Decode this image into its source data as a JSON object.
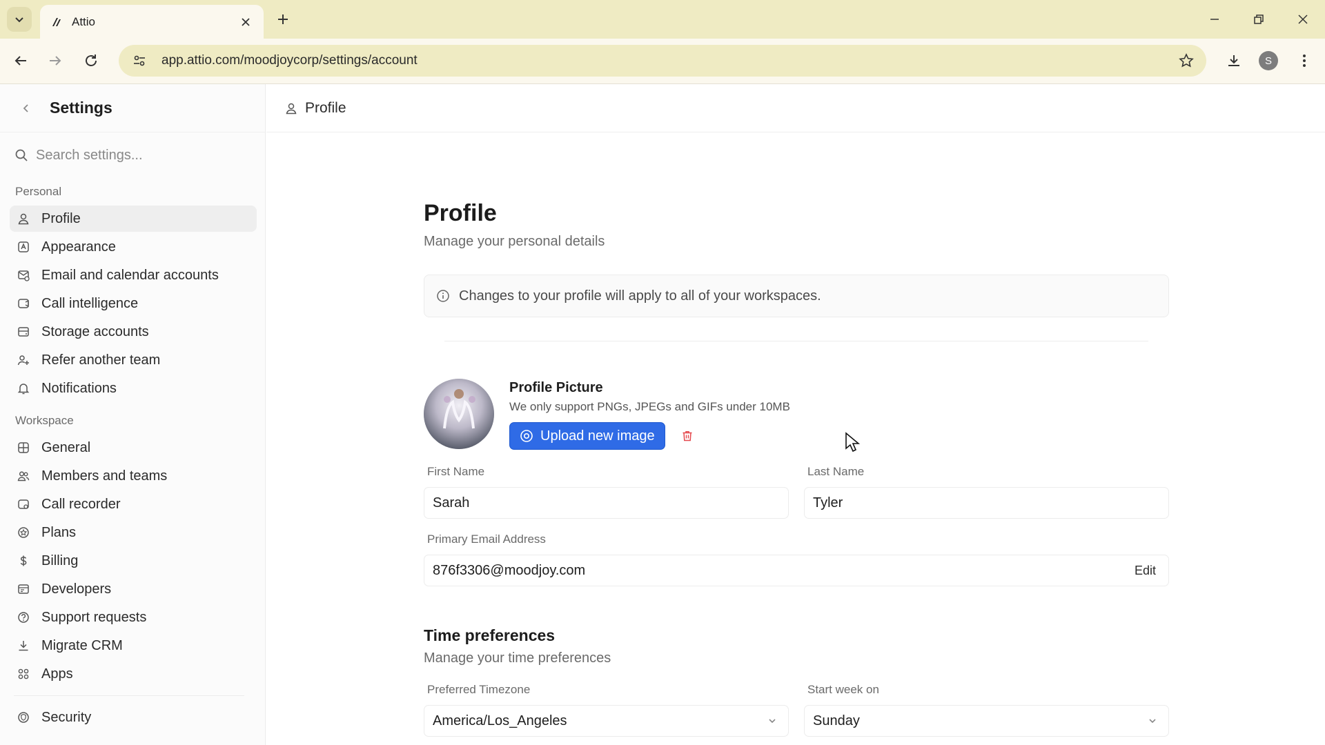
{
  "browser": {
    "tab_title": "Attio",
    "url": "app.attio.com/moodjoycorp/settings/account",
    "profile_initial": "S"
  },
  "sidebar": {
    "title": "Settings",
    "search_placeholder": "Search settings...",
    "personal_heading": "Personal",
    "personal_items": [
      {
        "label": "Profile",
        "icon": "user-icon",
        "active": true
      },
      {
        "label": "Appearance",
        "icon": "appearance-icon"
      },
      {
        "label": "Email and calendar accounts",
        "icon": "mail-calendar-icon"
      },
      {
        "label": "Call intelligence",
        "icon": "call-intelligence-icon"
      },
      {
        "label": "Storage accounts",
        "icon": "storage-icon"
      },
      {
        "label": "Refer another team",
        "icon": "refer-icon"
      },
      {
        "label": "Notifications",
        "icon": "bell-icon"
      }
    ],
    "workspace_heading": "Workspace",
    "workspace_items": [
      {
        "label": "General",
        "icon": "grid-icon"
      },
      {
        "label": "Members and teams",
        "icon": "members-icon"
      },
      {
        "label": "Call recorder",
        "icon": "recorder-icon"
      },
      {
        "label": "Plans",
        "icon": "plans-icon"
      },
      {
        "label": "Billing",
        "icon": "dollar-icon"
      },
      {
        "label": "Developers",
        "icon": "developers-icon"
      },
      {
        "label": "Support requests",
        "icon": "help-icon"
      },
      {
        "label": "Migrate CRM",
        "icon": "download-icon"
      },
      {
        "label": "Apps",
        "icon": "apps-icon"
      },
      {
        "label": "Security",
        "icon": "shield-icon"
      }
    ]
  },
  "breadcrumb": {
    "label": "Profile"
  },
  "page": {
    "title": "Profile",
    "subtitle": "Manage your personal details",
    "info": "Changes to your profile will apply to all of your workspaces."
  },
  "profile_picture": {
    "title": "Profile Picture",
    "hint": "We only support PNGs, JPEGs and GIFs under 10MB",
    "upload_label": "Upload new image"
  },
  "fields": {
    "first_name_label": "First Name",
    "first_name": "Sarah",
    "last_name_label": "Last Name",
    "last_name": "Tyler",
    "email_label": "Primary Email Address",
    "email": "876f3306@moodjoy.com",
    "email_edit": "Edit"
  },
  "time_prefs": {
    "title": "Time preferences",
    "subtitle": "Manage your time preferences",
    "timezone_label": "Preferred Timezone",
    "timezone": "America/Los_Angeles",
    "week_label": "Start week on",
    "week": "Sunday"
  },
  "colors": {
    "accent": "#2f6be6",
    "delete": "#e5484d",
    "chrome": "#efebc3"
  }
}
